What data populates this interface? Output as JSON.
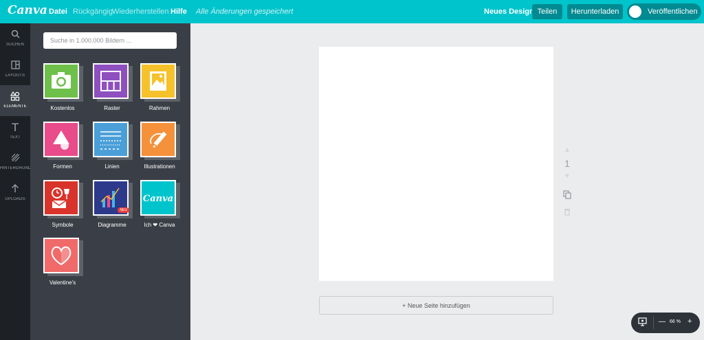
{
  "topbar": {
    "logo": "Canva",
    "menu": [
      "Datei",
      "Rückgängig",
      "Wiederherstellen",
      "Hilfe"
    ],
    "saved_status": "Alle Änderungen gespeichert",
    "design_name": "Neues Design",
    "share_label": "Teilen",
    "download_label": "Herunterladen",
    "publish_label": "Veröffentlichen"
  },
  "rail": {
    "items": [
      {
        "label": "SUCHEN",
        "icon": "search-icon"
      },
      {
        "label": "LAYOUTS",
        "icon": "layouts-icon"
      },
      {
        "label": "ELEMENTE",
        "icon": "shapes-icon"
      },
      {
        "label": "TEXT",
        "icon": "text-icon"
      },
      {
        "label": "HINTERGRUND",
        "icon": "background-icon"
      },
      {
        "label": "UPLOADS",
        "icon": "upload-icon"
      }
    ],
    "active": "ELEMENTE"
  },
  "panel": {
    "search_placeholder": "Suche in 1.000.000 Bildern ...",
    "tiles": [
      {
        "label": "Kostenlos",
        "color": "#6fbf4b",
        "icon": "camera-icon"
      },
      {
        "label": "Raster",
        "color": "#8e4fbf",
        "icon": "grid-icon"
      },
      {
        "label": "Rahmen",
        "color": "#f6c22b",
        "icon": "frame-icon"
      },
      {
        "label": "Formen",
        "color": "#e94b8b",
        "icon": "shapes-icon"
      },
      {
        "label": "Linien",
        "color": "#4a9fd8",
        "icon": "lines-icon"
      },
      {
        "label": "Illustrationen",
        "color": "#f4913a",
        "icon": "pencil-icon"
      },
      {
        "label": "Symbole",
        "color": "#d9342b",
        "icon": "symbols-icon"
      },
      {
        "label": "Diagramme",
        "color": "#2d3a8c",
        "icon": "chart-icon",
        "badge": "NEU"
      },
      {
        "label": "Ich ❤ Canva",
        "color": "#00c4cc",
        "icon": "canva-logo-icon",
        "logo_text": "Canva"
      },
      {
        "label": "Valentine's",
        "color": "#f06a6a",
        "icon": "heart-icon"
      }
    ]
  },
  "canvas": {
    "page_number": "1",
    "add_page_label": "+ Neue Seite hinzufügen"
  },
  "zoom": {
    "value": "66 %"
  }
}
